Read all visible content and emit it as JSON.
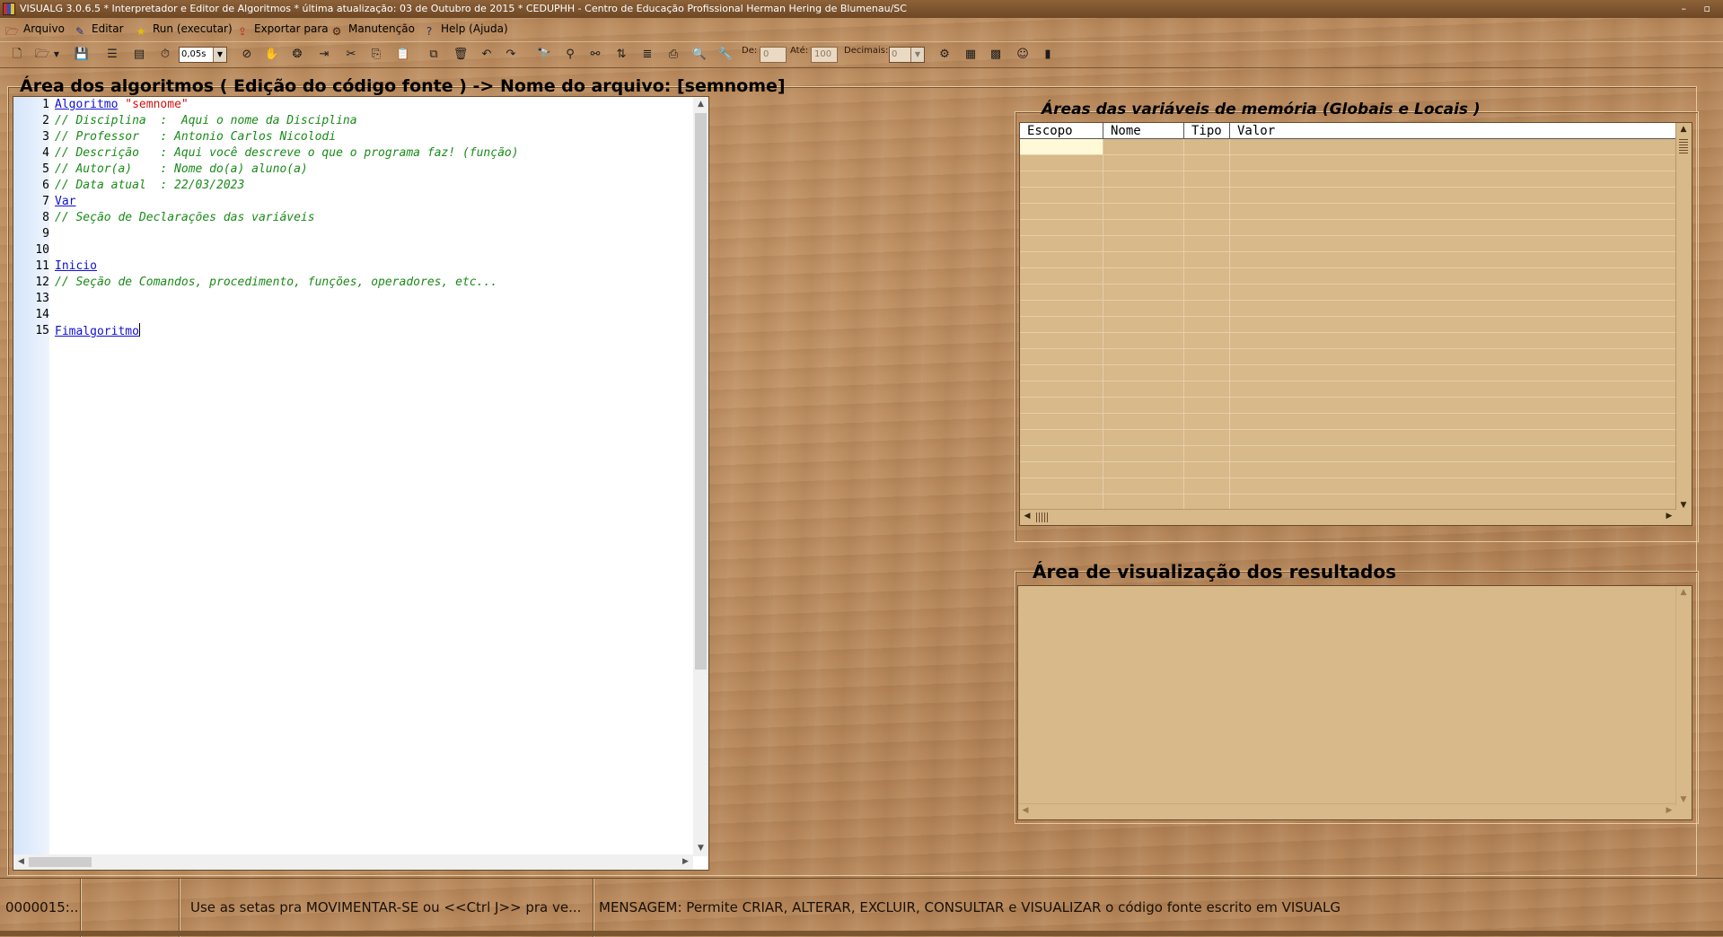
{
  "window": {
    "title": "VISUALG 3.0.6.5 * Interpretador e Editor de Algoritmos * última atualização: 03 de Outubro de 2015 * CEDUPHH - Centro de Educação Profissional Herman Hering de Blumenau/SC",
    "controls": "–  ▫"
  },
  "menu": [
    {
      "label": "Arquivo",
      "icon": "file-menu-icon"
    },
    {
      "label": "Editar",
      "icon": "edit-menu-icon"
    },
    {
      "label": "Run (executar)",
      "icon": "run-icon"
    },
    {
      "label": "Exportar para",
      "icon": "export-icon"
    },
    {
      "label": "Manutenção",
      "icon": "maintenance-icon"
    },
    {
      "label": "Help (Ajuda)",
      "icon": "help-icon"
    }
  ],
  "toolbar": {
    "speed_value": "0,05s",
    "de_label": "De:",
    "de_value": "0",
    "ate_label": "Até:",
    "ate_value": "100",
    "decimais_label": "Decimais:",
    "decimais_value": "0"
  },
  "editor": {
    "title": "Área dos algoritmos ( Edição do código fonte ) -> Nome do arquivo: [semnome]",
    "lines": [
      {
        "n": "1",
        "kw": "Algoritmo",
        "str": "\"semnome\"",
        "cmt": ""
      },
      {
        "n": "2",
        "kw": "",
        "str": "",
        "cmt": "// Disciplina  :  Aqui o nome da Disciplina"
      },
      {
        "n": "3",
        "kw": "",
        "str": "",
        "cmt": "// Professor   : Antonio Carlos Nicolodi"
      },
      {
        "n": "4",
        "kw": "",
        "str": "",
        "cmt": "// Descrição   : Aqui você descreve o que o programa faz! (função)"
      },
      {
        "n": "5",
        "kw": "",
        "str": "",
        "cmt": "// Autor(a)    : Nome do(a) aluno(a)"
      },
      {
        "n": "6",
        "kw": "",
        "str": "",
        "cmt": "// Data atual  : 22/03/2023"
      },
      {
        "n": "7",
        "kw": "Var",
        "str": "",
        "cmt": ""
      },
      {
        "n": "8",
        "kw": "",
        "str": "",
        "cmt": "// Seção de Declarações das variáveis"
      },
      {
        "n": "9",
        "kw": "",
        "str": "",
        "cmt": ""
      },
      {
        "n": "10",
        "kw": "",
        "str": "",
        "cmt": ""
      },
      {
        "n": "11",
        "kw": "Inicio",
        "str": "",
        "cmt": ""
      },
      {
        "n": "12",
        "kw": "",
        "str": "",
        "cmt": "// Seção de Comandos, procedimento, funções, operadores, etc..."
      },
      {
        "n": "13",
        "kw": "",
        "str": "",
        "cmt": ""
      },
      {
        "n": "14",
        "kw": "",
        "str": "",
        "cmt": ""
      },
      {
        "n": "15",
        "kw": "Fimalgoritmo",
        "str": "",
        "cmt": ""
      }
    ]
  },
  "variables": {
    "title": "Áreas das variáveis de memória (Globais e Locais )",
    "columns": [
      "Escopo",
      "Nome",
      "Tipo",
      "Valor"
    ]
  },
  "output": {
    "title": "Área de visualização dos resultados"
  },
  "status": {
    "position": "0000015:...",
    "hint": "Use as setas pra MOVIMENTAR-SE ou <<Ctrl J>> pra ve...",
    "message": "MENSAGEM: Permite CRIAR, ALTERAR, EXCLUIR, CONSULTAR e VISUALIZAR o código fonte escrito em VISUALG"
  },
  "colors": {
    "keyword": "#1010d0",
    "string": "#d01010",
    "comment": "#1a8a1a",
    "wood": "#b98a5d"
  }
}
